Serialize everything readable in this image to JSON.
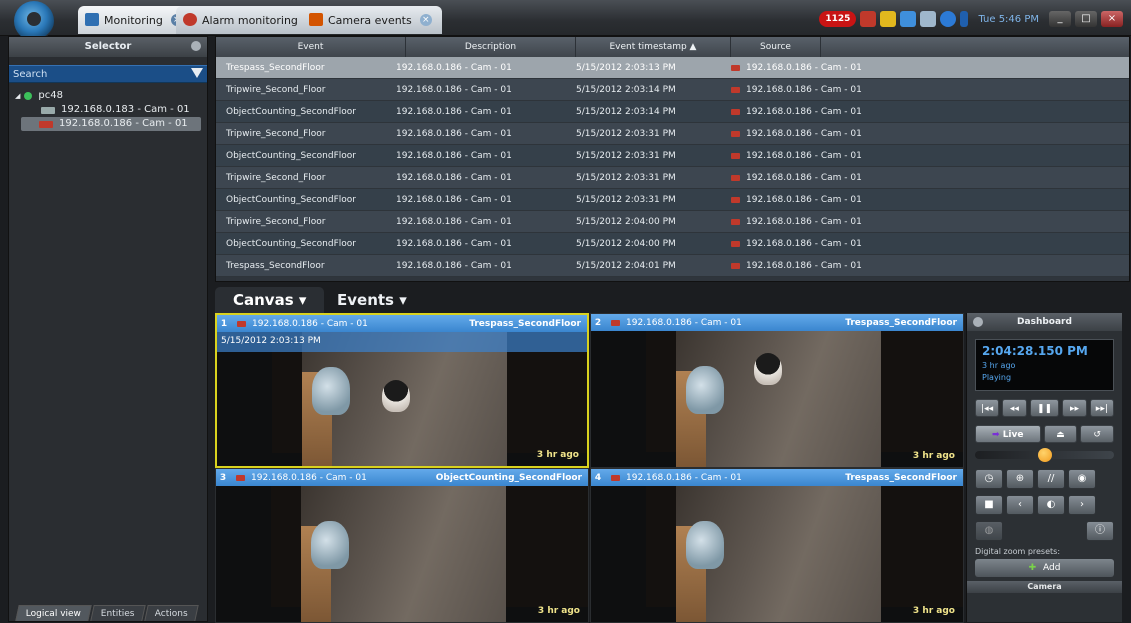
{
  "titlebar": {
    "tabs": [
      {
        "label": "Monitoring",
        "icon": "monitor-icon"
      },
      {
        "label": "Alarm monitoring",
        "icon": "alarm-icon"
      },
      {
        "label": "Camera events",
        "icon": "camera-events-icon"
      }
    ],
    "alarm_count": "1125",
    "clock": "Tue 5:46 PM",
    "colors": {
      "accent": "#3a86cf",
      "alarm": "#c81414"
    }
  },
  "selector": {
    "title": "Selector",
    "search_placeholder": "Search",
    "tree": [
      {
        "label": "pc48"
      },
      {
        "label": "192.168.0.183 - Cam - 01"
      },
      {
        "label": "192.168.0.186 - Cam - 01",
        "selected": true
      }
    ],
    "tabs": [
      "Logical view",
      "Entities",
      "Actions"
    ]
  },
  "events": {
    "columns": [
      "Event",
      "Description",
      "Event timestamp ▲",
      "Source"
    ],
    "rows": [
      {
        "event": "Trespass_SecondFloor",
        "description": "192.168.0.186 - Cam - 01",
        "timestamp": "5/15/2012 2:03:13 PM",
        "source": "192.168.0.186 - Cam - 01"
      },
      {
        "event": "Tripwire_Second_Floor",
        "description": "192.168.0.186 - Cam - 01",
        "timestamp": "5/15/2012 2:03:14 PM",
        "source": "192.168.0.186 - Cam - 01"
      },
      {
        "event": "ObjectCounting_SecondFloor",
        "description": "192.168.0.186 - Cam - 01",
        "timestamp": "5/15/2012 2:03:14 PM",
        "source": "192.168.0.186 - Cam - 01"
      },
      {
        "event": "Tripwire_Second_Floor",
        "description": "192.168.0.186 - Cam - 01",
        "timestamp": "5/15/2012 2:03:31 PM",
        "source": "192.168.0.186 - Cam - 01"
      },
      {
        "event": "ObjectCounting_SecondFloor",
        "description": "192.168.0.186 - Cam - 01",
        "timestamp": "5/15/2012 2:03:31 PM",
        "source": "192.168.0.186 - Cam - 01"
      },
      {
        "event": "Tripwire_Second_Floor",
        "description": "192.168.0.186 - Cam - 01",
        "timestamp": "5/15/2012 2:03:31 PM",
        "source": "192.168.0.186 - Cam - 01"
      },
      {
        "event": "ObjectCounting_SecondFloor",
        "description": "192.168.0.186 - Cam - 01",
        "timestamp": "5/15/2012 2:03:31 PM",
        "source": "192.168.0.186 - Cam - 01"
      },
      {
        "event": "Tripwire_Second_Floor",
        "description": "192.168.0.186 - Cam - 01",
        "timestamp": "5/15/2012 2:04:00 PM",
        "source": "192.168.0.186 - Cam - 01"
      },
      {
        "event": "ObjectCounting_SecondFloor",
        "description": "192.168.0.186 - Cam - 01",
        "timestamp": "5/15/2012 2:04:00 PM",
        "source": "192.168.0.186 - Cam - 01"
      },
      {
        "event": "Trespass_SecondFloor",
        "description": "192.168.0.186 - Cam - 01",
        "timestamp": "5/15/2012 2:04:01 PM",
        "source": "192.168.0.186 - Cam - 01"
      }
    ]
  },
  "canvas": {
    "tabs": [
      "Canvas ▾",
      "Events ▾"
    ],
    "tiles": [
      {
        "num": "1",
        "camera": "192.168.0.186 - Cam - 01",
        "event": "Trespass_SecondFloor",
        "timestamp": "5/15/2012 2:03:13 PM",
        "ago": "3 hr ago"
      },
      {
        "num": "2",
        "camera": "192.168.0.186 - Cam - 01",
        "event": "Trespass_SecondFloor",
        "ago": "3 hr ago"
      },
      {
        "num": "3",
        "camera": "192.168.0.186 - Cam - 01",
        "event": "ObjectCounting_SecondFloor",
        "ago": "3 hr ago"
      },
      {
        "num": "4",
        "camera": "192.168.0.186 - Cam - 01",
        "event": "Trespass_SecondFloor",
        "ago": "3 hr ago"
      }
    ]
  },
  "dashboard": {
    "title": "Dashboard",
    "time": "2:04:28.150 PM",
    "ago": "3 hr ago",
    "status": "Playing",
    "live_label": "Live",
    "zoom_label": "Digital zoom presets:",
    "add_label": "Add",
    "camera_label": "Camera",
    "playback_position": 0.5
  }
}
